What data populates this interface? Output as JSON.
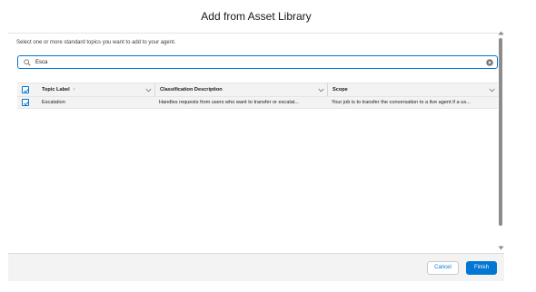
{
  "modal": {
    "title": "Add from Asset Library",
    "instruction": "Select one or more standard topics you want to add to your agent."
  },
  "search": {
    "value": "Esca",
    "search_icon": "search-icon",
    "clear_icon": "clear-icon"
  },
  "table": {
    "columns": [
      {
        "label": "Topic Label",
        "sort_indicator": "↑"
      },
      {
        "label": "Classification Description"
      },
      {
        "label": "Scope"
      }
    ],
    "header_checkbox_checked": true,
    "rows": [
      {
        "checked": true,
        "topic_label": "Escalation",
        "classification_description": "Handles requests from users who want to transfer or escalat...",
        "scope": "Your job is to transfer the conversation to a live agent if a us..."
      }
    ]
  },
  "footer": {
    "cancel_label": "Cancel",
    "finish_label": "Finish"
  },
  "colors": {
    "brand": "#0176d3",
    "header_bg": "#f3f3f3",
    "border": "#e5e5e5"
  }
}
